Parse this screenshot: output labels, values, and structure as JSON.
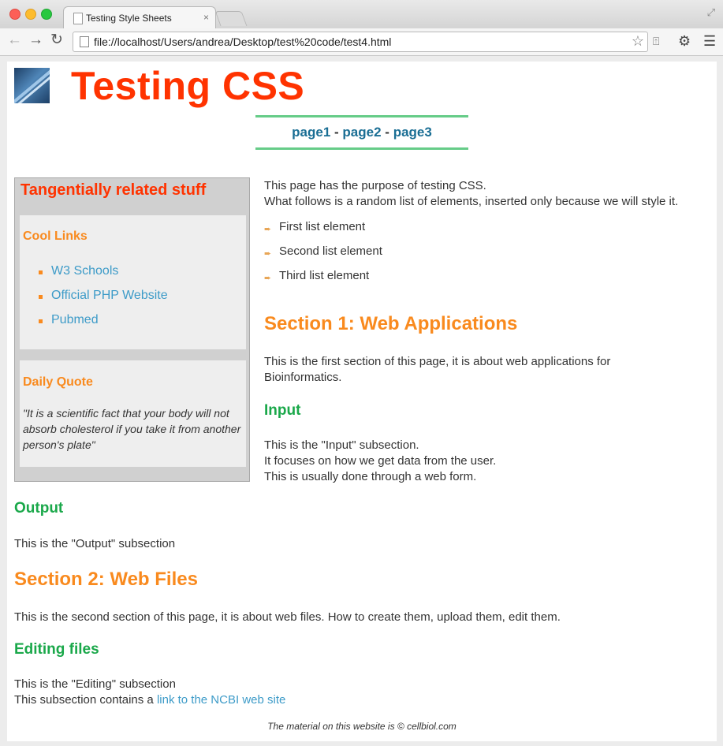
{
  "browser": {
    "tab_title": "Testing Style Sheets",
    "tab_close": "×",
    "url": "file://localhost/Users/andrea/Desktop/test%20code/test4.html",
    "icons": [
      "back-icon",
      "forward-icon",
      "reload-icon",
      "star-icon",
      "extension-icon",
      "gear-icon",
      "menu-icon"
    ]
  },
  "page": {
    "title": "Testing CSS",
    "nav": [
      "page1",
      "page2",
      "page3"
    ],
    "nav_separator": "-"
  },
  "sidebar": {
    "title": "Tangentially related stuff",
    "links_heading": "Cool Links",
    "links": [
      "W3 Schools",
      "Official PHP Website",
      "Pubmed"
    ],
    "quote_heading": "Daily Quote",
    "quote": "\"It is a scientific fact that your body will not absorb cholesterol if you take it from another person's plate\""
  },
  "main": {
    "intro_line1": "This page has the purpose of testing CSS.",
    "intro_line2": "What follows is a random list of elements, inserted only because we will style it.",
    "list": [
      "First list element",
      "Second list element",
      "Third list element"
    ],
    "section1_title": "Section 1: Web Applications",
    "section1_text": "This is the first section of this page, it is about web applications for Bioinformatics.",
    "input_title": "Input",
    "input_line1": "This is the \"Input\" subsection.",
    "input_line2": "It focuses on how we get data from the user.",
    "input_line3": "This is usually done through a web form.",
    "output_title": "Output",
    "output_text": "This is the \"Output\" subsection",
    "section2_title": "Section 2: Web Files",
    "section2_text": "This is the second section of this page, it is about web files. How to create them, upload them, edit them.",
    "editing_title": "Editing files",
    "editing_line1": "This is the \"Editing\" subsection",
    "editing_line2_prefix": "This subsection contains a",
    "editing_link": "link to the NCBI web site"
  },
  "footer": "The material on this website is © cellbiol.com",
  "colors": {
    "title": "#ff3300",
    "section": "#f98a1e",
    "subsection": "#1aa84a",
    "link": "#3d9bc8",
    "nav": "#1a6e94"
  }
}
